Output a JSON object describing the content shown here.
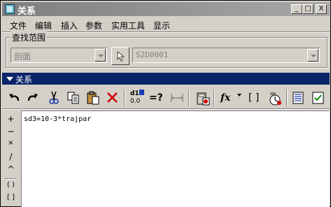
{
  "window": {
    "title": "关系",
    "buttons": {
      "minimize": "_",
      "maximize": "□",
      "close": "X"
    }
  },
  "menu": [
    {
      "label": "文件"
    },
    {
      "label": "编辑"
    },
    {
      "label": "插入"
    },
    {
      "label": "参数"
    },
    {
      "label": "实用工具"
    },
    {
      "label": "显示"
    }
  ],
  "search_scope": {
    "group_label": "查找范围",
    "type_value": "剖面",
    "id_value": "S2D0001"
  },
  "section": {
    "label": "关系"
  },
  "toolbar": {
    "equals_check": "=?",
    "function": "fx",
    "brackets": "[ ]",
    "units_top": "d1",
    "units_bottom": "0.0"
  },
  "operators": [
    "+",
    "−",
    "×",
    "/",
    "^",
    "( )",
    "[ ]"
  ],
  "editor": {
    "lines": [
      "sd3=10-3*trajpar"
    ]
  },
  "colors": {
    "titlebar_start": "#7f7f7f",
    "section_bar": "#0a246a",
    "window_bg": "#d4d0c8",
    "delete_icon": "#cc0000"
  }
}
